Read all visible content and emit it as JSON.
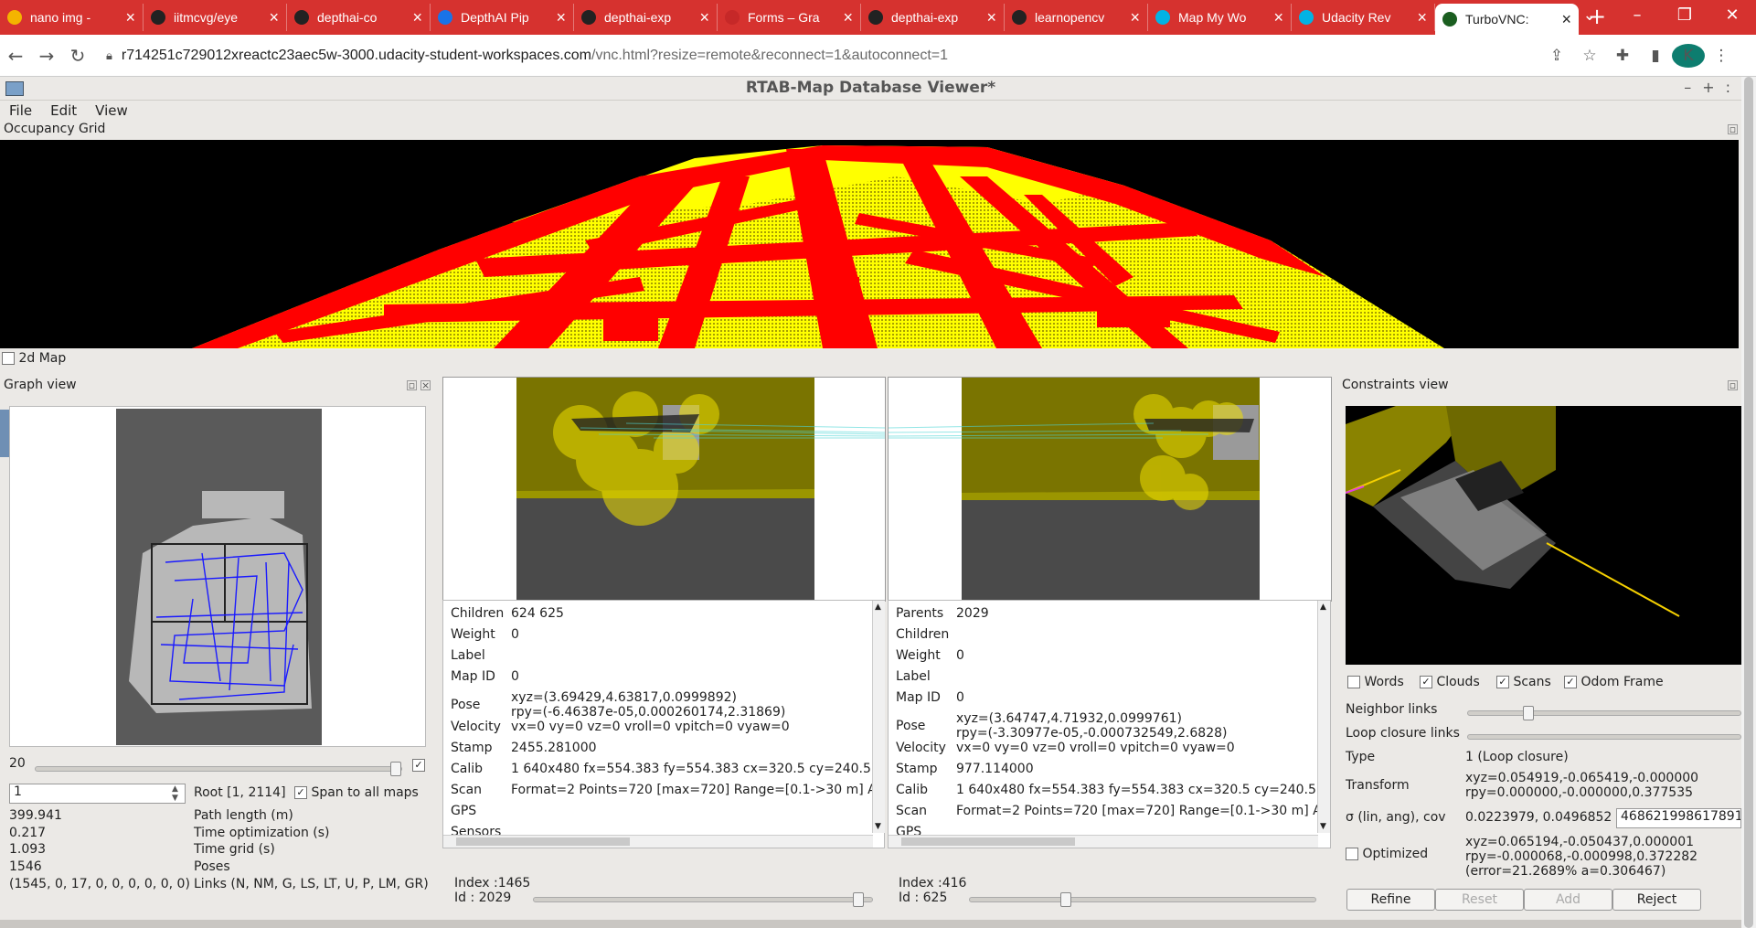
{
  "browser": {
    "tabs": [
      {
        "title": "nano img - ",
        "icon": "google-drive-icon",
        "color": "#f4b400"
      },
      {
        "title": "iitmcvg/eye",
        "icon": "github-icon",
        "color": "#222"
      },
      {
        "title": "depthai-co",
        "icon": "github-icon",
        "color": "#222"
      },
      {
        "title": "DepthAI Pip",
        "icon": "depthai-icon",
        "color": "#1a73e8"
      },
      {
        "title": "depthai-exp",
        "icon": "github-icon",
        "color": "#222"
      },
      {
        "title": "Forms – Gra",
        "icon": "forms-icon",
        "color": "#c62828"
      },
      {
        "title": "depthai-exp",
        "icon": "github-icon",
        "color": "#222"
      },
      {
        "title": "learnopencv",
        "icon": "github-icon",
        "color": "#222"
      },
      {
        "title": "Map My Wo",
        "icon": "udacity-icon",
        "color": "#02b3e4"
      },
      {
        "title": "Udacity Rev",
        "icon": "udacity-icon",
        "color": "#02b3e4"
      },
      {
        "title": "TurboVNC:",
        "icon": "turbovnc-icon",
        "color": "#1b5e20",
        "active": true
      }
    ],
    "new_tab": "+",
    "url_host": "r714251c729012xreactc23aec5w-3000.udacity-student-workspaces.com",
    "url_path": "/vnc.html?resize=remote&reconnect=1&autoconnect=1",
    "profile_initial": "K"
  },
  "app": {
    "title": "RTAB-Map Database Viewer*",
    "menu": [
      "File",
      "Edit",
      "View"
    ],
    "occupancy_title": "Occupancy Grid",
    "map2d_label": "2d Map",
    "graph_title": "Graph view",
    "constraints_title": "Constraints view",
    "graph_slider_value": "20",
    "root_input": "1",
    "root_label": "Root [1, 2114]",
    "span_label": "Span to all maps",
    "stats": [
      {
        "value": "399.941",
        "label": "Path length (m)"
      },
      {
        "value": "0.217",
        "label": "Time optimization (s)"
      },
      {
        "value": "1.093",
        "label": "Time grid (s)"
      },
      {
        "value": "1546",
        "label": "Poses"
      },
      {
        "value": "(1545, 0, 17, 0, 0, 0, 0, 0, 0)",
        "label": "Links (N, NM, G, LS, LT, U, P, LM, GR)"
      }
    ],
    "left_info": [
      {
        "k": "Children",
        "v": "624 625"
      },
      {
        "k": "Weight",
        "v": "0"
      },
      {
        "k": "Label",
        "v": ""
      },
      {
        "k": "Map ID",
        "v": "0"
      },
      {
        "k": "Pose",
        "v": "xyz=(3.69429,4.63817,0.0999892)",
        "v2": "rpy=(-6.46387e-05,0.000260174,2.31869)"
      },
      {
        "k": "Velocity",
        "v": "vx=0 vy=0 vz=0 vroll=0 vpitch=0 vyaw=0"
      },
      {
        "k": "Stamp",
        "v": "2455.281000"
      },
      {
        "k": "Calib",
        "v": "1 640x480 fx=554.383 fy=554.383 cx=320.5 cy=240.5 T"
      },
      {
        "k": "Scan",
        "v": "Format=2 Points=720 [max=720] Range=[0.1->30 m] A"
      },
      {
        "k": "GPS",
        "v": ""
      },
      {
        "k": "Sensors",
        "v": ""
      }
    ],
    "right_info": [
      {
        "k": "Parents",
        "v": "2029"
      },
      {
        "k": "Children",
        "v": ""
      },
      {
        "k": "Weight",
        "v": "0"
      },
      {
        "k": "Label",
        "v": ""
      },
      {
        "k": "Map ID",
        "v": "0"
      },
      {
        "k": "Pose",
        "v": "xyz=(3.64747,4.71932,0.0999761)",
        "v2": "rpy=(-3.30977e-05,-0.000732549,2.6828)"
      },
      {
        "k": "Velocity",
        "v": "vx=0 vy=0 vz=0 vroll=0 vpitch=0 vyaw=0"
      },
      {
        "k": "Stamp",
        "v": "977.114000"
      },
      {
        "k": "Calib",
        "v": "1 640x480 fx=554.383 fy=554.383 cx=320.5 cy=240.5 T"
      },
      {
        "k": "Scan",
        "v": "Format=2 Points=720 [max=720] Range=[0.1->30 m] A"
      },
      {
        "k": "GPS",
        "v": ""
      }
    ],
    "left_index": "Index :1465",
    "left_id": "Id :   2029",
    "right_index": "Index :416",
    "right_id": "Id :    625",
    "left_slider_fraction": 0.97,
    "right_slider_fraction": 0.27,
    "constraints": {
      "checks": [
        {
          "label": "Words",
          "checked": false
        },
        {
          "label": "Clouds",
          "checked": true
        },
        {
          "label": "Scans",
          "checked": true
        },
        {
          "label": "Odom Frame",
          "checked": true
        }
      ],
      "neighbor_links": "Neighbor links",
      "loop_links": "Loop closure links",
      "type_label": "Type",
      "type_value": "1  (Loop closure)",
      "transform_label": "Transform",
      "transform_1": "xyz=0.054919,-0.065419,-0.000000",
      "transform_2": "rpy=0.000000,-0.000000,0.377535",
      "sigma_label": "σ (lin, ang), cov",
      "sigma_value": "0.0223979, 0.0496852",
      "cov_value": "468621998617891",
      "optimized_label": "Optimized",
      "opt_1": "xyz=0.065194,-0.050437,0.000001",
      "opt_2": "rpy=-0.000068,-0.000998,0.372282",
      "opt_3": "(error=21.2689% a=0.306467)",
      "buttons": {
        "refine": "Refine",
        "reset": "Reset",
        "add": "Add",
        "reject": "Reject"
      }
    }
  },
  "colors": {
    "chrome_red": "#d6322f",
    "occupied": "#ff0000",
    "free": "#ffff00",
    "path": "#1a1aff"
  }
}
